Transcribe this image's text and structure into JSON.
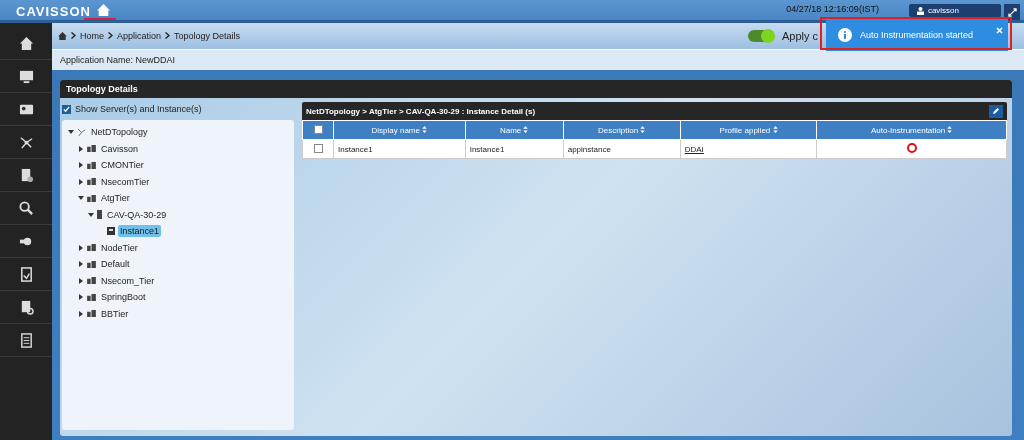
{
  "header": {
    "logo": "CAVISSON",
    "datetime": "04/27/18 12:16:09(IST)",
    "user": "cavisson"
  },
  "breadcrumb": [
    "Home",
    "Application",
    "Topology Details"
  ],
  "toggle": {
    "label": "Apply c",
    "on": true
  },
  "toast": {
    "message": "Auto Instrumentation started"
  },
  "app_name": "Application Name: NewDDAI",
  "panel": {
    "title": "Topology Details"
  },
  "show_servers": {
    "label": "Show Server(s) and Instance(s)",
    "checked": true
  },
  "tree": [
    {
      "label": "NetDTopology",
      "kind": "root",
      "expanded": true,
      "selected": false,
      "children": [
        {
          "label": "Cavisson",
          "kind": "tier",
          "expanded": false,
          "selected": false
        },
        {
          "label": "CMONTier",
          "kind": "tier",
          "expanded": false,
          "selected": false
        },
        {
          "label": "NsecomTier",
          "kind": "tier",
          "expanded": false,
          "selected": false
        },
        {
          "label": "AtgTier",
          "kind": "tier",
          "expanded": true,
          "selected": false,
          "children": [
            {
              "label": "CAV-QA-30-29",
              "kind": "server",
              "expanded": true,
              "selected": false,
              "children": [
                {
                  "label": "Instance1",
                  "kind": "instance",
                  "selected": true
                }
              ]
            }
          ]
        },
        {
          "label": "NodeTier",
          "kind": "tier",
          "expanded": false,
          "selected": false
        },
        {
          "label": "Default",
          "kind": "tier",
          "expanded": false,
          "selected": false
        },
        {
          "label": "Nsecom_Tier",
          "kind": "tier",
          "expanded": false,
          "selected": false
        },
        {
          "label": "SpringBoot",
          "kind": "tier",
          "expanded": false,
          "selected": false
        },
        {
          "label": "BBTier",
          "kind": "tier",
          "expanded": false,
          "selected": false
        }
      ]
    }
  ],
  "table": {
    "title": "NetDTopology > AtgTier > CAV-QA-30-29 : Instance Detail (s)",
    "all_checked": false,
    "columns": [
      "Display name",
      "Name",
      "Description",
      "Profile applied",
      "Auto-Instrumentation"
    ],
    "rows": [
      {
        "checked": false,
        "display_name": "Instance1",
        "name": "Instance1",
        "description": "appinstance",
        "profile": "DDAI",
        "auto_instrumentation": false
      }
    ]
  }
}
